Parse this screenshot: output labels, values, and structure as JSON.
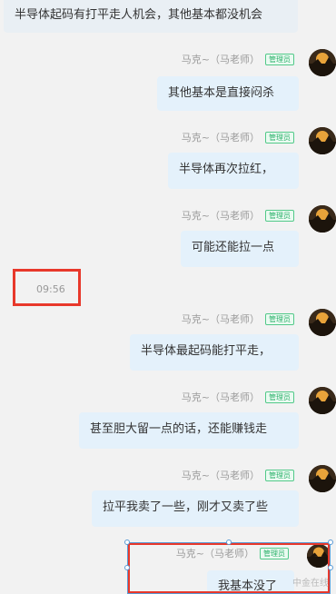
{
  "messages": [
    {
      "text": "半导体起码有打平走人机会，其他基本都没机会",
      "side": "left",
      "cut": true
    },
    {
      "sender": "马克~（马老师）",
      "badge": "管理员",
      "text": "其他基本是直接闷杀"
    },
    {
      "sender": "马克~（马老师）",
      "badge": "管理员",
      "text": "半导体再次拉红，"
    },
    {
      "sender": "马克~（马老师）",
      "badge": "管理员",
      "text": "可能还能拉一点"
    },
    {
      "sender": "马克~（马老师）",
      "badge": "管理员",
      "text": "半导体最起码能打平走，"
    },
    {
      "sender": "马克~（马老师）",
      "badge": "管理员",
      "text": "甚至胆大留一点的话，还能赚钱走"
    },
    {
      "sender": "马克~（马老师）",
      "badge": "管理员",
      "text": "拉平我卖了一些，刚才又卖了些"
    },
    {
      "sender": "马克~（马老师）",
      "badge": "管理员",
      "text": "我基本没了",
      "cut": true
    }
  ],
  "time_divider": "09:56",
  "watermark": "中金在线",
  "colors": {
    "background": "#f2f2f2",
    "bubble": "#e4f1fb",
    "highlight": "#e8382b",
    "badge": "#2fb36d"
  },
  "icons": {
    "avatar": "sunset-silhouette-avatar"
  }
}
